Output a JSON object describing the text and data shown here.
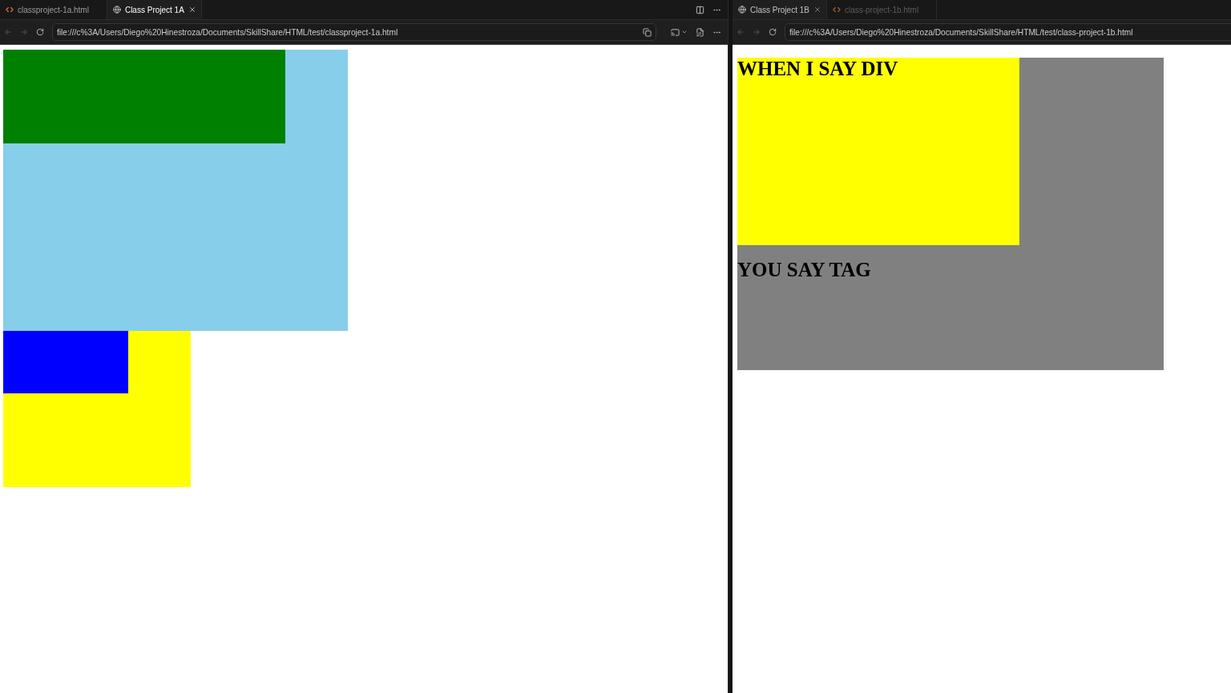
{
  "panes": [
    {
      "focused": true,
      "tabs": [
        {
          "kind": "file",
          "label": "classproject-1a.html",
          "selected": false
        },
        {
          "kind": "preview",
          "label": "Class Project 1A",
          "selected": true
        }
      ],
      "navigation": [
        {
          "kind": "back",
          "disabled": true
        },
        {
          "kind": "forward",
          "disabled": true
        },
        {
          "kind": "reload",
          "disabled": false
        }
      ],
      "address": {
        "value": "file:///c%3A/Users/Diego%20Hinestroza/Documents/SkillShare/HTML/test/classproject-1a.html"
      },
      "page": {
        "blocks": [
          {
            "color": "#87ceeb",
            "children": [
              {
                "color": "#008000"
              }
            ]
          },
          {
            "color": "#ffff00",
            "children": [
              {
                "color": "#0000ff"
              }
            ]
          }
        ]
      }
    },
    {
      "focused": false,
      "tabs": [
        {
          "kind": "preview",
          "label": "Class Project 1B",
          "selected": true
        },
        {
          "kind": "file",
          "label": "class-project-1b.html",
          "selected": false
        }
      ],
      "navigation": [
        {
          "kind": "back",
          "disabled": true
        },
        {
          "kind": "forward",
          "disabled": true
        },
        {
          "kind": "reload",
          "disabled": false
        }
      ],
      "address": {
        "value": "file:///c%3A/Users/Diego%20Hinestroza/Documents/SkillShare/HTML/test/class-project-1b.html"
      },
      "page": {
        "blocks": [
          {
            "color": "#808080",
            "children": [
              {
                "color": "#ffff00",
                "heading": "WHEN I SAY DIV"
              }
            ],
            "heading": "YOU SAY TAG"
          }
        ]
      }
    }
  ]
}
